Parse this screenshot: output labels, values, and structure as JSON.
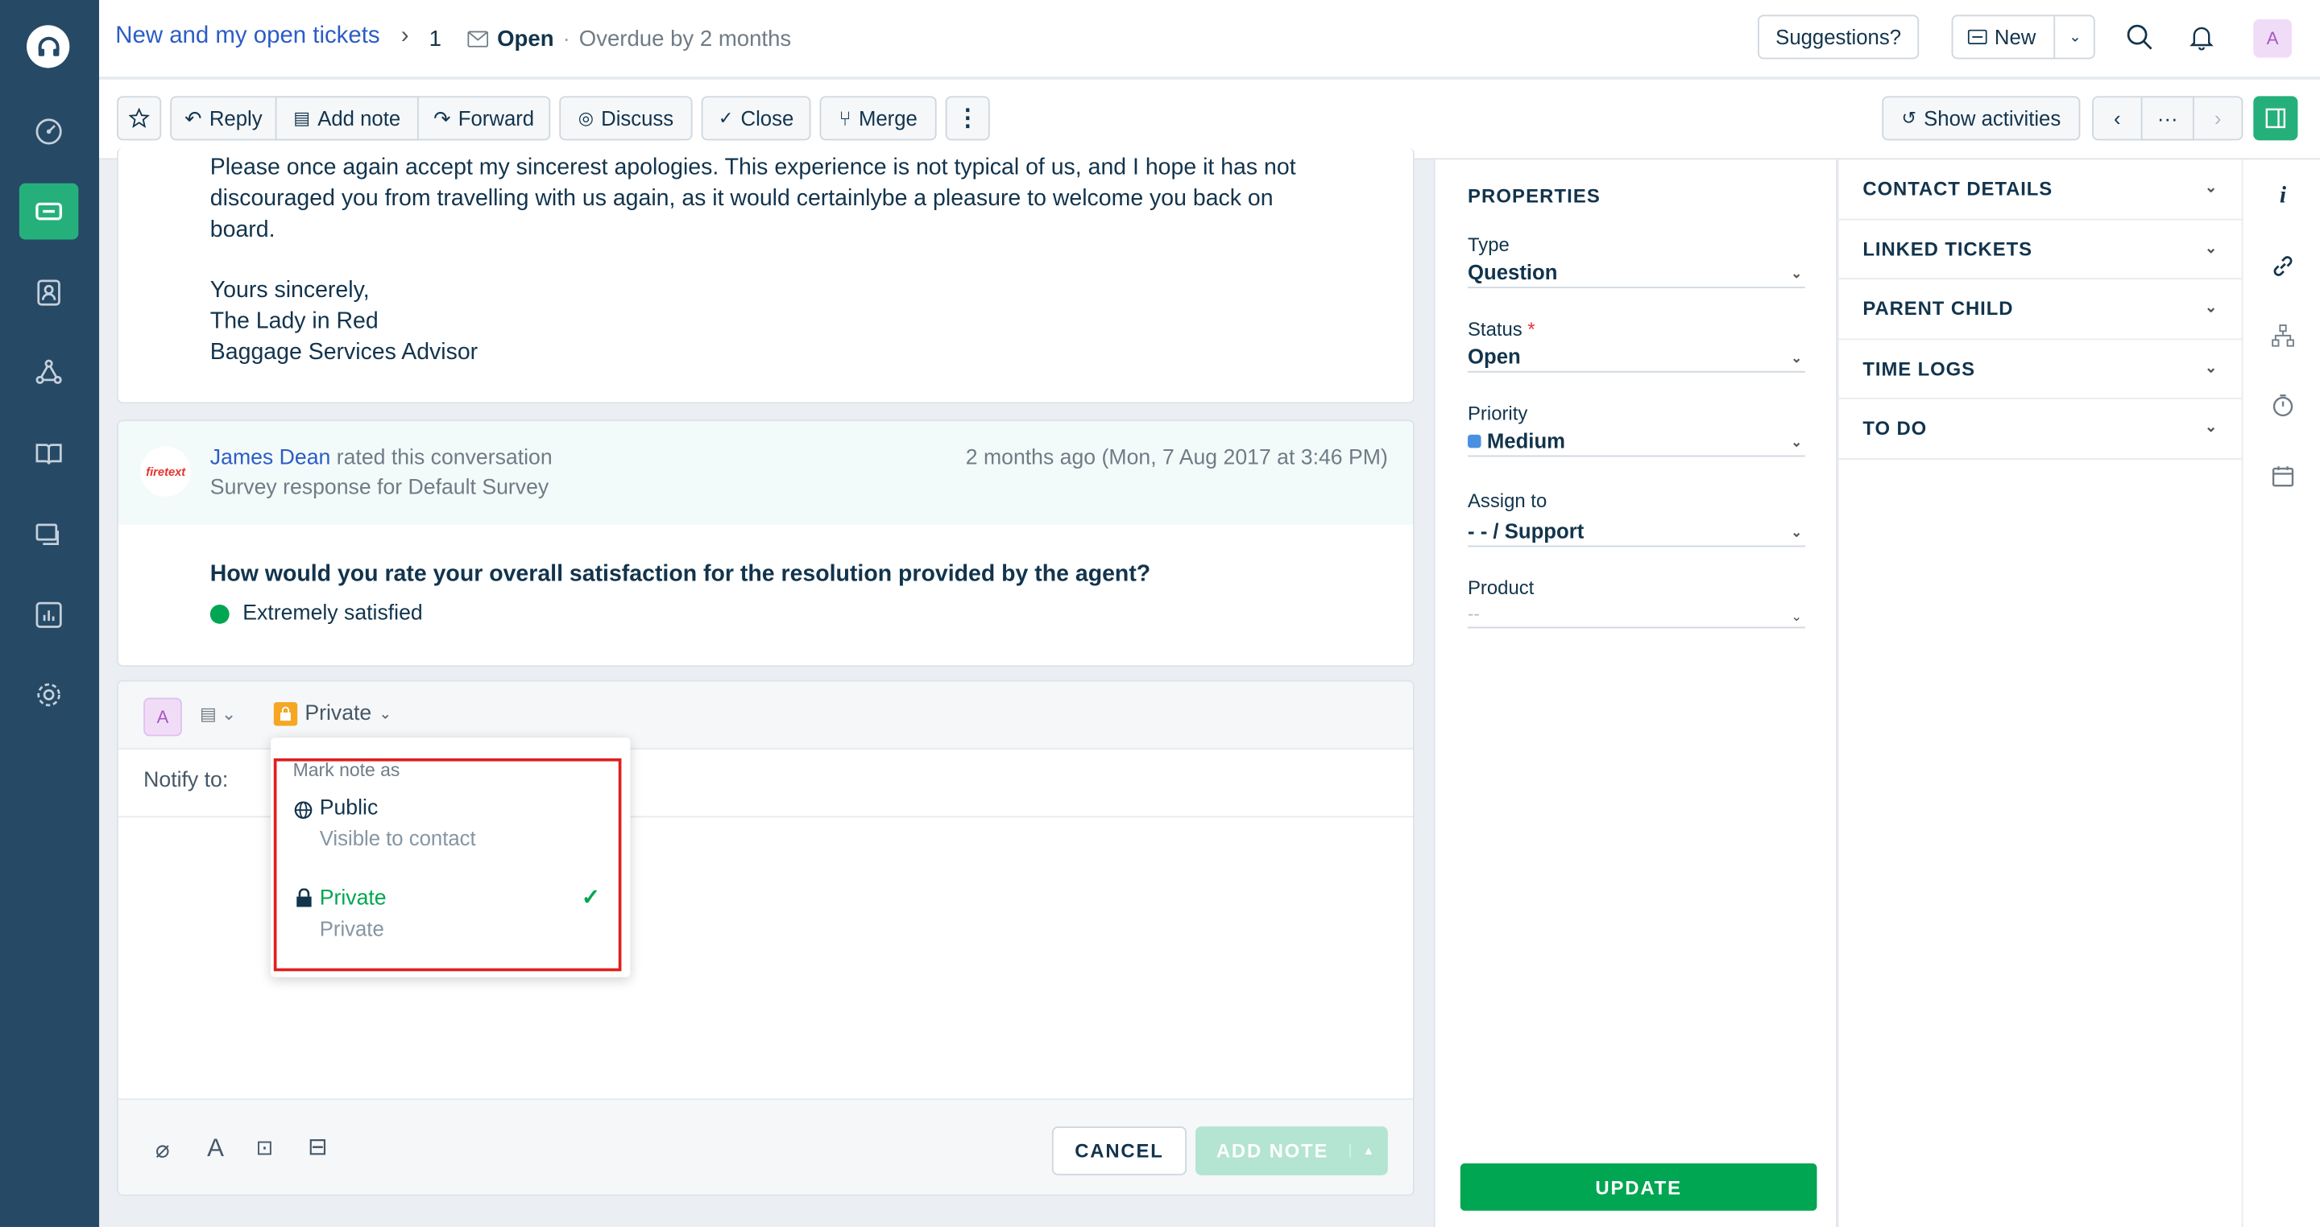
{
  "header": {
    "breadcrumb": "New and my open tickets",
    "ticket_number": "1",
    "status": "Open",
    "overdue": "Overdue by 2 months",
    "suggestions_label": "Suggestions?",
    "new_label": "New",
    "user_initial": "A"
  },
  "toolbar": {
    "reply": "Reply",
    "add_note": "Add note",
    "forward": "Forward",
    "discuss": "Discuss",
    "close": "Close",
    "merge": "Merge",
    "show_activities": "Show activities",
    "more": "···"
  },
  "message": {
    "lines": [
      "Please once again accept my sincerest apologies. This experience is not typical of us, and I hope it has not",
      "discouraged you from travelling with us again, as it would certainlybe a pleasure to welcome you back on",
      "board."
    ],
    "signature": [
      "Yours sincerely,",
      "The Lady in Red",
      "Baggage Services Advisor"
    ]
  },
  "survey": {
    "author": "James Dean",
    "action": "rated this conversation",
    "subtitle": "Survey response for Default Survey",
    "time": "2 months ago (Mon, 7 Aug 2017 at 3:46 PM)",
    "question": "How would you rate your overall satisfaction for the resolution provided by the agent?",
    "answer": "Extremely satisfied",
    "answer_color": "#00a651",
    "logo_text": "firetext"
  },
  "editor": {
    "avatar": "A",
    "visibility": "Private",
    "notify_label": "Notify to:",
    "cancel": "CANCEL",
    "add_note": "ADD NOTE"
  },
  "dropdown": {
    "heading": "Mark note as",
    "options": [
      {
        "title": "Public",
        "subtitle": "Visible to contact",
        "icon": "globe-icon"
      },
      {
        "title": "Private",
        "subtitle": "Private",
        "icon": "lock-icon",
        "selected": true
      }
    ]
  },
  "properties": {
    "heading": "PROPERTIES",
    "type_label": "Type",
    "type_value": "Question",
    "status_label": "Status",
    "status_value": "Open",
    "priority_label": "Priority",
    "priority_value": "Medium",
    "priority_color": "#4a90e2",
    "assign_label": "Assign to",
    "assign_value": "- - / Support",
    "product_label": "Product",
    "product_value": "--",
    "update": "UPDATE"
  },
  "sidebar_sections": [
    "CONTACT DETAILS",
    "LINKED TICKETS",
    "PARENT CHILD",
    "TIME LOGS",
    "TO DO"
  ],
  "colors": {
    "nav_bg": "#264966",
    "accent_green": "#00a651",
    "link_blue": "#2c5cc5"
  }
}
